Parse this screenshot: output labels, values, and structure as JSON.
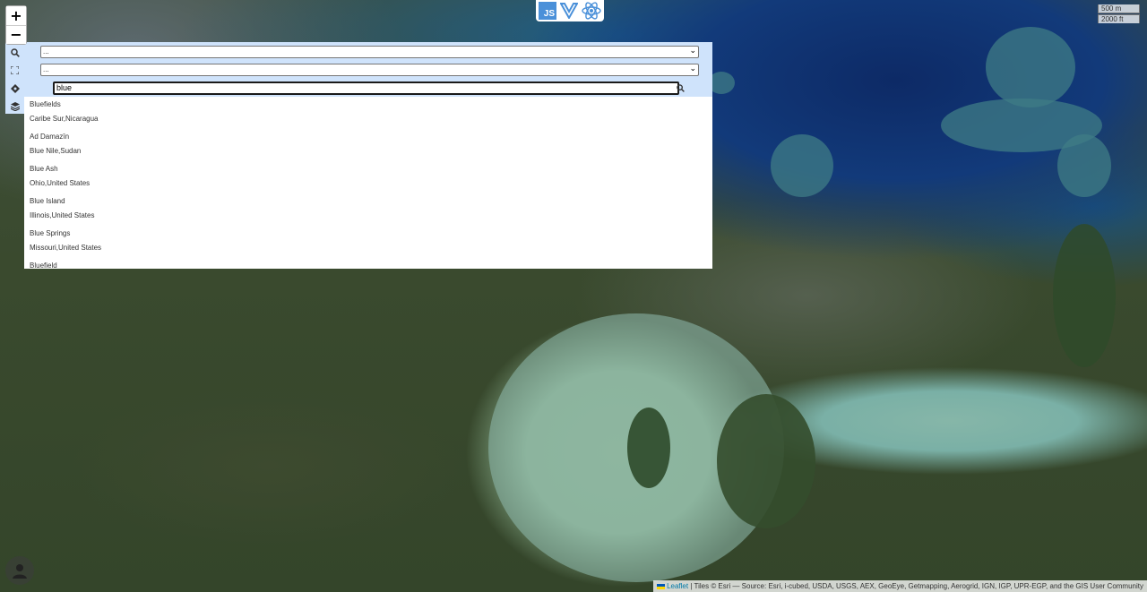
{
  "map": {
    "zoom_in_label": "+",
    "zoom_out_label": "−",
    "scale_metric": "500 m",
    "scale_imperial": "2000 ft",
    "attribution_link": "Leaflet",
    "attribution_text": "| Tiles © Esri — Source: Esri, i-cubed, USDA, USGS, AEX, GeoEye, Getmapping, Aerogrid, IGN, IGP, UPR-EGP, and the GIS User Community"
  },
  "frameworks": {
    "js_label": "JS",
    "icons": [
      "javascript-icon",
      "vue-icon",
      "react-icon"
    ]
  },
  "panel": {
    "tools": [
      "search-icon",
      "fullscreen-icon",
      "locate-icon",
      "layers-icon"
    ],
    "select_1": "...",
    "select_2": "...",
    "search_value": "blue",
    "results": [
      {
        "name": "Bluefields",
        "region": "Caribe Sur,Nicaragua"
      },
      {
        "name": "Ad Damazīn",
        "region": "Blue Nile,Sudan"
      },
      {
        "name": "Blue Ash",
        "region": "Ohio,United States"
      },
      {
        "name": "Blue Island",
        "region": "Illinois,United States"
      },
      {
        "name": "Blue Springs",
        "region": "Missouri,United States"
      },
      {
        "name": "Bluefield",
        "region": ""
      }
    ]
  },
  "colors": {
    "panel_bg": "#cfe3fb",
    "link": "#0078a8",
    "js_badge": "#4a90d9",
    "vue": "#41b883",
    "react": "#4a90d9"
  }
}
